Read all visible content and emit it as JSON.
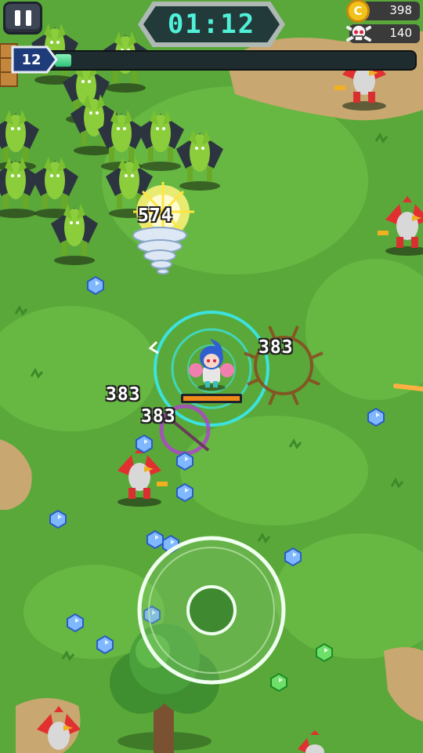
{
  "hud": {
    "pause_icon": "pause-icon",
    "timer": "01:12",
    "coins": "398",
    "coin_icon": "coin-icon",
    "kills": "140",
    "kill_icon": "skull-icon",
    "level": "12",
    "xp_progress": 0.02
  },
  "damage_numbers": [
    "574",
    "383",
    "383",
    "383"
  ],
  "colors": {
    "grass": "#5aa83a",
    "grass_light": "#6cbb45",
    "dirt": "#c9a770",
    "timer_text": "#50f0d8",
    "xp_fill": "#2ec27a",
    "player_aura": "#38e8f0"
  },
  "entities": {
    "player": "player-hero",
    "enemies_green": "green-moth-enemy",
    "enemies_red": "red-rooster-enemy",
    "gems": "xp-gem",
    "joystick": "virtual-joystick"
  }
}
